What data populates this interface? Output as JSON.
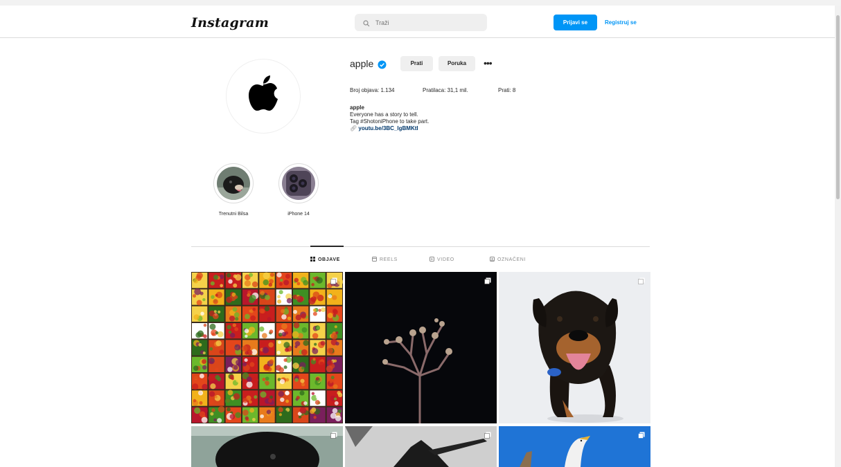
{
  "header": {
    "logo": "Instagram",
    "search_placeholder": "Traži",
    "login_label": "Prijavi se",
    "register_label": "Registruj se"
  },
  "profile": {
    "username": "apple",
    "follow_label": "Prati",
    "message_label": "Poruka",
    "more_label": "•••",
    "stats": {
      "posts": "Broj objava: 1.134",
      "followers": "Pratilaca: 31,1 mil.",
      "following": "Prati: 8"
    },
    "bio": {
      "name": "apple",
      "line1": "Everyone has a story to tell.",
      "line2": "Tag #ShotoniPhone to take part.",
      "link": "youtu.be/3BC_lgBMKtI"
    }
  },
  "highlights": [
    {
      "label": "Trenutni Bilsa",
      "icon": "dog-photo"
    },
    {
      "label": "iPhone 14",
      "icon": "iphone-camera-photo"
    }
  ],
  "tabs": [
    {
      "label": "OBJAVE",
      "icon": "grid-icon",
      "active": true
    },
    {
      "label": "REELS",
      "icon": "reels-icon",
      "active": false
    },
    {
      "label": "VIDEO",
      "icon": "video-icon",
      "active": false
    },
    {
      "label": "OZNAČENI",
      "icon": "tag-icon",
      "active": false
    }
  ],
  "colors": {
    "accent": "#0095f6",
    "link": "#00376b",
    "text": "#262626",
    "muted": "#8e8e8e",
    "verified": "#0095f6"
  },
  "posts": [
    {
      "subject": "fruit-market",
      "multi": true
    },
    {
      "subject": "joshua-tree-night",
      "multi": true
    },
    {
      "subject": "rottweiler",
      "multi": true
    },
    {
      "subject": "black-dog",
      "multi": true
    },
    {
      "subject": "black-white-hand",
      "multi": true
    },
    {
      "subject": "seagull-blue-sky",
      "multi": true
    }
  ]
}
